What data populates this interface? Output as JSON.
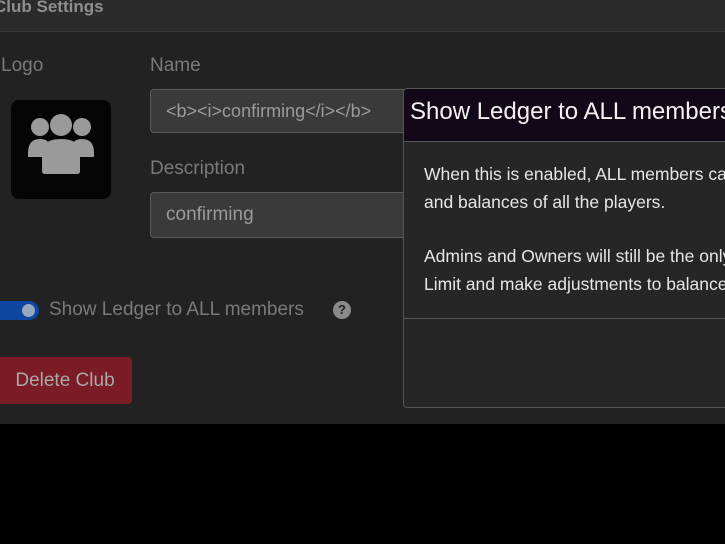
{
  "panel": {
    "title": "Club Settings",
    "logo_label": "Logo",
    "logo_icon": "users-group-icon",
    "name_label": "Name",
    "name_value": "<b><i>confirming</i></b>",
    "description_label": "Description",
    "description_value": "confirming",
    "ledger_toggle_label": "Show Ledger to ALL members",
    "ledger_toggle_on": true,
    "help_icon_glyph": "?",
    "delete_button_label": "Delete Club",
    "colors": {
      "toggle_on": "#0d47a1",
      "delete_button": "#7a1b26"
    }
  },
  "modal": {
    "title": "Show Ledger to ALL members",
    "body_line_1": "When this is enabled, ALL members can see the",
    "body_line_2": "and balances of all the players.",
    "body_line_3": "Admins and Owners will still be the only ones",
    "body_line_4": "Limit and make adjustments to balances."
  }
}
